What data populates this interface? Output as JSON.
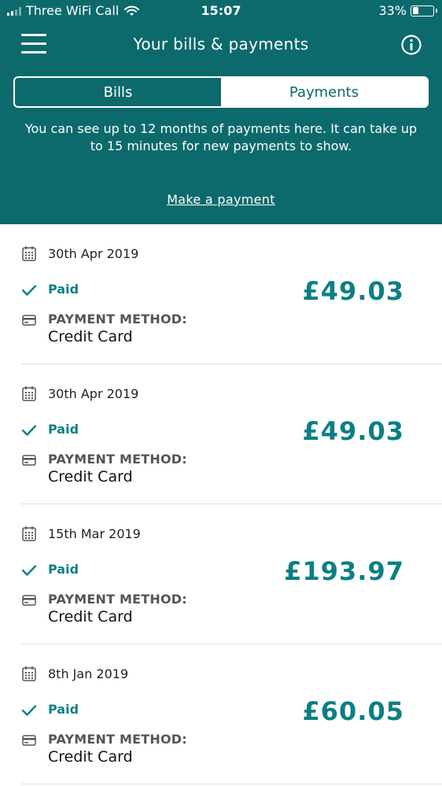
{
  "status_bar": {
    "carrier": "Three WiFi Call",
    "time": "15:07",
    "battery": "33%",
    "battery_level": 0.33
  },
  "nav": {
    "title": "Your bills & payments",
    "menu_icon": "hamburger-menu-icon",
    "info_icon": "info-icon"
  },
  "tabs": {
    "bills": "Bills",
    "payments": "Payments",
    "selected": "Payments"
  },
  "info_text": "You can see up to 12 months of payments here. It can take up to 15 minutes for new payments to show.",
  "make_payment_link": "Make a payment",
  "colors": {
    "header_bg": "#0c6a6c",
    "accent": "#0c7f83"
  },
  "payments": [
    {
      "date": "30th Apr 2019",
      "status": "Paid",
      "amount": "£49.03",
      "method_label": "PAYMENT METHOD:",
      "method": "Credit Card"
    },
    {
      "date": "30th Apr 2019",
      "status": "Paid",
      "amount": "£49.03",
      "method_label": "PAYMENT METHOD:",
      "method": "Credit Card"
    },
    {
      "date": "15th Mar 2019",
      "status": "Paid",
      "amount": "£193.97",
      "method_label": "PAYMENT METHOD:",
      "method": "Credit Card"
    },
    {
      "date": "8th Jan 2019",
      "status": "Paid",
      "amount": "£60.05",
      "method_label": "PAYMENT METHOD:",
      "method": "Credit Card"
    }
  ]
}
